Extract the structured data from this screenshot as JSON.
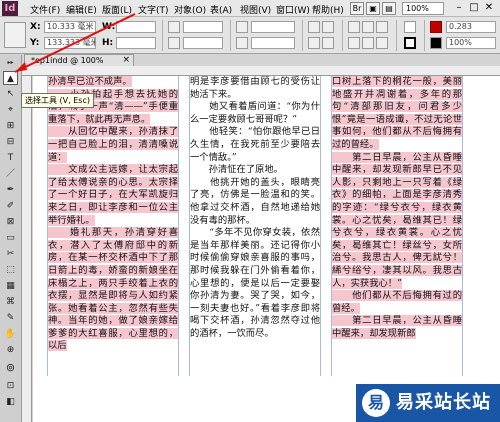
{
  "app": {
    "logo": "Id"
  },
  "menubar": {
    "items": [
      "文件(F)",
      "编辑(E)",
      "版面(L)",
      "文字(T)",
      "对象(O)",
      "表(A)",
      "视图(V)",
      "窗口(W)",
      "帮助(H)"
    ],
    "zoom": "100%",
    "minimize": "–",
    "maximize": "□",
    "close": "✕"
  },
  "controlbar": {
    "x_label": "X:",
    "y_label": "Y:",
    "x_value": "10.333 毫米",
    "y_value": "133.333 毫米",
    "w_label": "W:",
    "h_label": "H:",
    "stroke_weight": "0.283",
    "percent": "100%"
  },
  "document": {
    "tab_title": "*ep1indd @ 100%",
    "tab_close": "×"
  },
  "tooltip": {
    "text": "选择工具 (V, Esc)"
  },
  "tools": [
    "▲",
    "↖",
    "⌖",
    "⊞",
    "⊟",
    "✎",
    "T",
    "／",
    "✒",
    "✐",
    "⊠",
    "▭",
    "✂",
    "⬚",
    "▦",
    "✋",
    "⊕",
    "⊚",
    "◐",
    "⊡",
    "⌘",
    "◧"
  ],
  "columns": [
    {
      "paragraphs": [
        {
          "text": "孙清早已泣不成声。",
          "highlight": true
        },
        {
          "text": "　　小孙拍起手想去抚她的泪，喊了一声“清——”手便重重落下，就此再无声息。",
          "highlight": true
        },
        {
          "text": "　　从回忆中醒来，孙清抹了一把自己脸上的泪，清清嗓说道：",
          "highlight": true
        },
        {
          "text": "　　文成公主远嫁，让太宗起了给太傅说亲的心思。太宗择了一个好日子，在大军凯旋归来之日，即让李彦和一位公主举行婚礼。",
          "highlight": true
        },
        {
          "text": "　　婚礼那天，孙清穿好喜衣，潜入了太傅府邸中的新房，在某一杯交杯酒中下了那日箭上的毒，娇蛮的新娘坐在床榻之上，两只手绞着上衣的衣摆，显然是即将与人如约紧张。她看着公主，忽然有些失神。当年的她，做了娘亲嫁给爹爹的大红喜服，心里想的，以后",
          "highlight": true
        }
      ]
    },
    {
      "paragraphs": [
        {
          "text": "明是李彦要借由顾七的受伤让她活下来。",
          "highlight": false
        },
        {
          "text": "　　她又看着盾问道：“你为什么一定要救顾七哥哥呢？”",
          "highlight": false
        },
        {
          "text": "　　他轻笑：“怕你跟他早已日久生情，在我死前至少要陪去一个情敌。”",
          "highlight": false
        },
        {
          "text": "　　孙清怔在了原地。",
          "highlight": false
        },
        {
          "text": "　　他挑开她的盖头，眼睛亮了亮，仿佛是一脸温和的笑。他拿过交杯酒，自然地递给她没有毒的那杯。",
          "highlight": false
        },
        {
          "text": "　　“多年不见你穿女装，依然是当年那样美丽。还记得你小时候偷偷穿娘亲喜服的事吗，那时候我躲在门外偷看着你，心里想的，便是以后一定要娶你孙清为妻。哭了哭，如今，一刻夫妻也好。”看着李彦即将喝下交杯酒，孙清忽然夺过他的酒杯，一饮而尽。",
          "highlight": false
        }
      ]
    },
    {
      "paragraphs": [
        {
          "text": "口树上落下的桐花一般，美丽地盛开并凋谢着，多年的那句“清部那旧友，问君多少恨”竟是一语成谶，不过无论世事如何，他们都从不后悔拥有过的曾经。",
          "highlight": true
        },
        {
          "text": "　　第二日早晨，公主从昏睡中醒来，却发现新郎早已不见人影，只剩地上一只写着《绿衣》的细帕，上面是李彦清秀的字迹：“绿兮衣兮，绿衣黄裳。心之忧矣，曷维其已！绿兮衣兮，绿衣黄裳。心之忧矣，曷维其亡！绿丝兮，女所治兮。我思古人，俾无訧兮！絺兮绤兮，凄其以风。我思古人，实获我心！”",
          "highlight": true
        },
        {
          "text": "　　他们都从不后悔拥有过的曾经。",
          "highlight": true
        },
        {
          "text": "　　第二日早晨，公主从昏睡中醒来，却发现新郎",
          "highlight": true
        }
      ]
    }
  ],
  "watermark": {
    "logo": "易",
    "text": "易采站长站"
  }
}
